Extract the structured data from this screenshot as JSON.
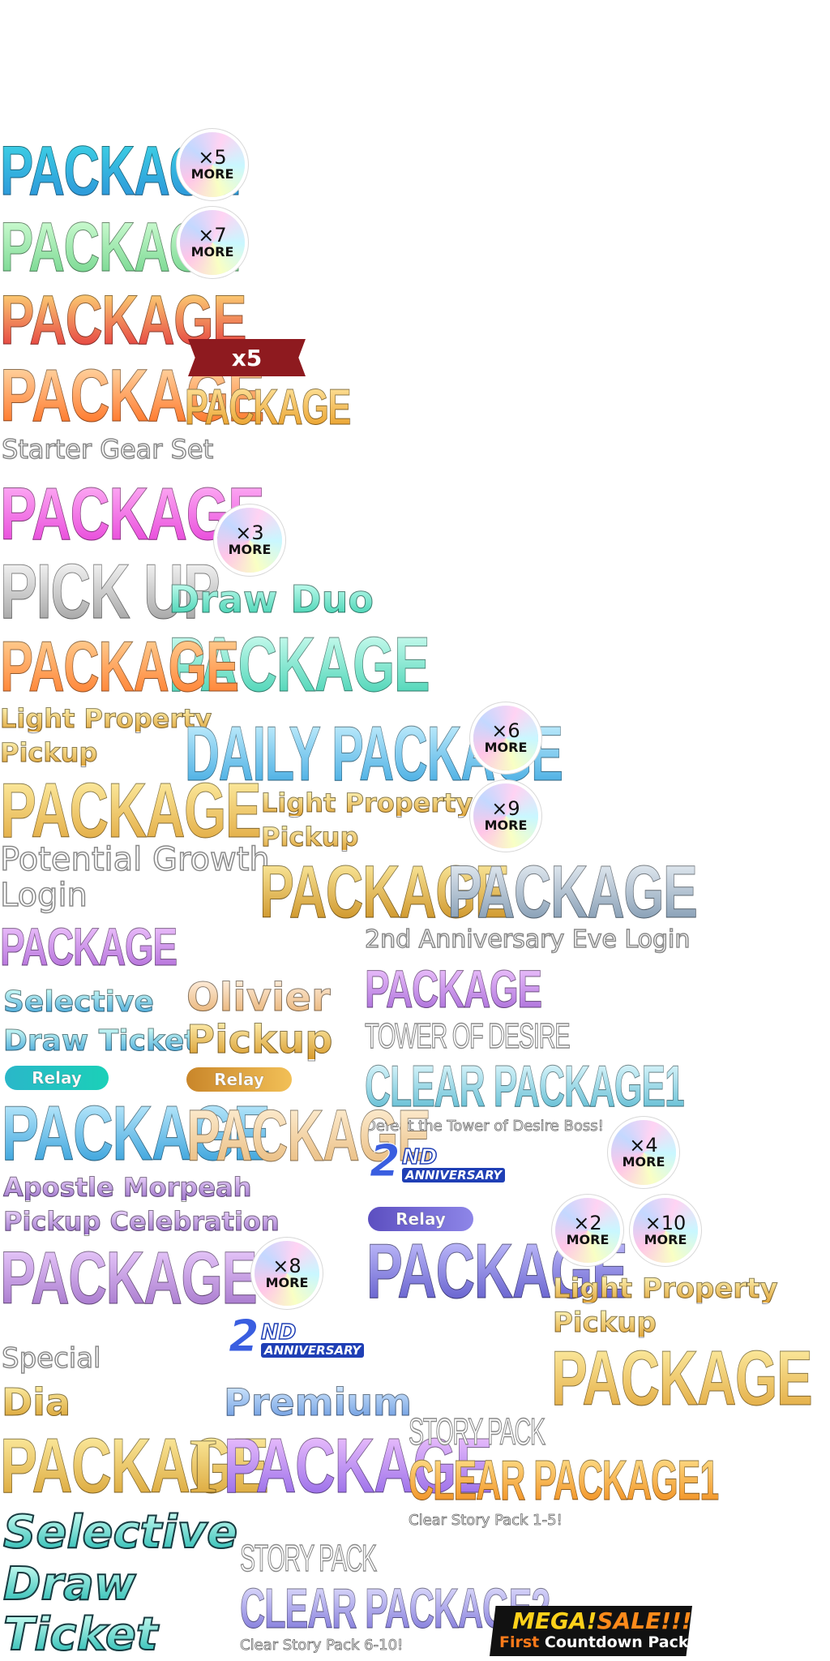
{
  "texts": {
    "package": "PACKAGE",
    "pick_up": "PICK UP",
    "daily_package": "DAILY PACKAGE",
    "starter_gear_set": "Starter Gear Set",
    "draw_duo": "Draw Duo",
    "light_property_1": "Light Property",
    "light_property_2": "Pickup",
    "potential_1": "Potential Growth",
    "potential_2": "Login",
    "anniv_eve": "2nd Anniversary Eve Login",
    "tower_1": "TOWER OF DESIRE",
    "tower_2": "CLEAR PACKAGE1",
    "tower_caption": "Defeat the Tower of Desire Boss!",
    "selective_1": "Selective",
    "selective_2": "Draw Ticket",
    "olivier_1": "Olivier",
    "olivier_2": "Pickup",
    "relay": "Relay",
    "apostle_1": "Apostle Morpeah",
    "apostle_2": "Pickup Celebration",
    "special": "Special",
    "dia": "Dia",
    "roman_one": "I",
    "premium": "Premium",
    "story_pack": "STORY PACK",
    "clear_package1": "CLEAR PACKAGE1",
    "clear_package2": "CLEAR PACKAGE2",
    "story_caption_1": "Clear Story Pack 1-5!",
    "story_caption_2": "Clear Story Pack 6-10!",
    "sel_big_1": "Selective",
    "sel_big_2": "Draw",
    "sel_big_3": "Ticket",
    "anniv_2": "2",
    "anniv_nd": "ND",
    "anniv_word": "ANNIVERSARY",
    "ribbon": "x5",
    "mega_1a": "MEGA!",
    "mega_1b": "SALE!!!",
    "mega_2a": "First",
    "mega_2b": " Countdown Package",
    "more": "MORE"
  },
  "badges": [
    "×5",
    "×7",
    "×3",
    "×6",
    "×9",
    "×4",
    "×2",
    "×10",
    "×8"
  ],
  "colors": {
    "cyan_blue": [
      "#3fd6e6",
      "#2a8fd8"
    ],
    "mint": [
      "#c6f7c8",
      "#6fd48a"
    ],
    "sunset": [
      "#ffe07a",
      "#e2303a"
    ],
    "orange": [
      "#ffd59a",
      "#ff7a2a"
    ],
    "pink": [
      "#ff9ef0",
      "#e63fd8"
    ],
    "silver": [
      "#ffffff",
      "#a0a0a0"
    ],
    "teal": [
      "#b6fff0",
      "#3ed0b0"
    ],
    "gold": [
      "#fff1a8",
      "#e0a53a"
    ],
    "steel": [
      "#e8eef4",
      "#7a94ad"
    ],
    "lavender": [
      "#f2c8ff",
      "#a76ad8"
    ],
    "violet": [
      "#b8b4ff",
      "#5a55c8"
    ],
    "purple": [
      "#f0b8ff",
      "#8e63e6"
    ]
  }
}
